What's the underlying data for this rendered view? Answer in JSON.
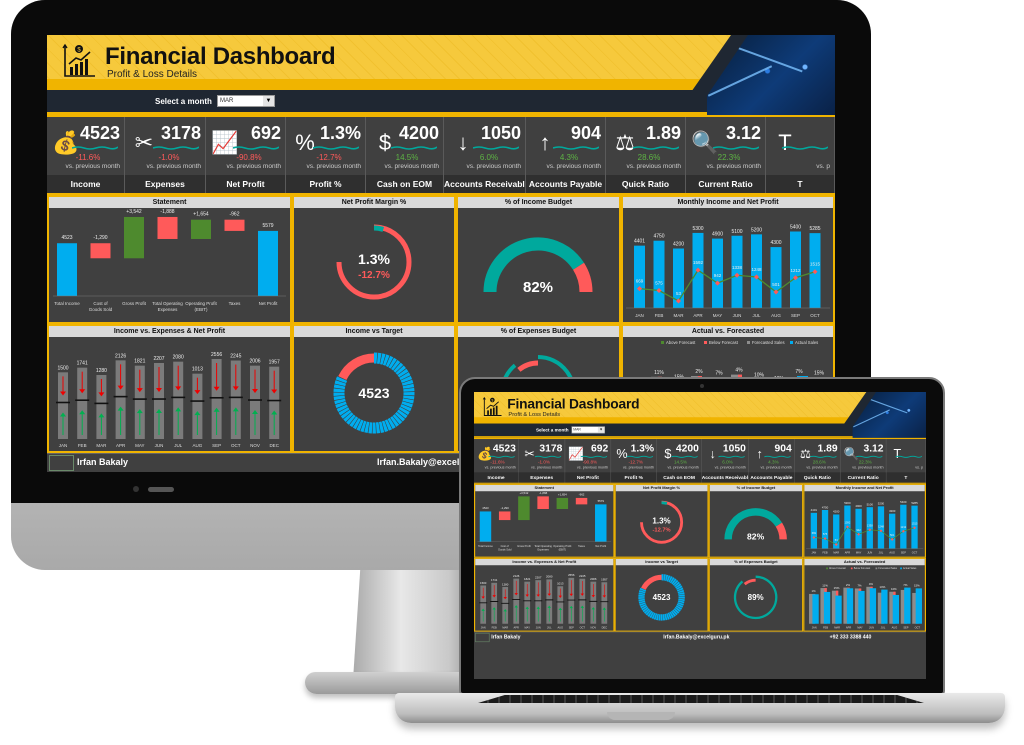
{
  "dashboard": {
    "title": "Financial Dashboard",
    "subtitle": "Profit & Loss Details",
    "month_selector": {
      "label": "Select a month",
      "value": "MAR"
    },
    "colors": {
      "accent": "#f0b400",
      "header_yellow": "#f6c93c",
      "navy": "#1f2732",
      "panel_bg": "#404040",
      "blue": "#00adef",
      "teal": "#00a99d",
      "red": "#ff5a5a",
      "green": "#4e8a2e",
      "bright_green": "#00b050"
    },
    "kpis": [
      {
        "icon": "money-bag-hand-icon",
        "glyph": "💰",
        "value": "4523",
        "change": "-11.6%",
        "trend": "negative",
        "vs": "vs. previous month",
        "label": "Income"
      },
      {
        "icon": "scissors-dollar-icon",
        "glyph": "✂",
        "value": "3178",
        "change": "-1.0%",
        "trend": "negative",
        "vs": "vs. previous month",
        "label": "Expenses"
      },
      {
        "icon": "growth-chart-icon",
        "glyph": "📈",
        "value": "692",
        "change": "-90.8%",
        "trend": "negative",
        "vs": "vs. previous month",
        "label": "Net Profit"
      },
      {
        "icon": "percent-hand-icon",
        "glyph": "%",
        "value": "1.3%",
        "change": "-12.7%",
        "trend": "negative",
        "vs": "vs. previous month",
        "label": "Profit %"
      },
      {
        "icon": "cash-bill-icon",
        "glyph": "$",
        "value": "4200",
        "change": "14.5%",
        "trend": "positive",
        "vs": "vs. previous month",
        "label": "Cash on EOM"
      },
      {
        "icon": "receivable-down-icon",
        "glyph": "↓",
        "value": "1050",
        "change": "6.0%",
        "trend": "positive",
        "vs": "vs. previous month",
        "label": "Accounts Receivable"
      },
      {
        "icon": "payable-up-icon",
        "glyph": "↑",
        "value": "904",
        "change": "4.3%",
        "trend": "positive",
        "vs": "vs. previous month",
        "label": "Accounts Payable"
      },
      {
        "icon": "balance-scale-icon",
        "glyph": "⚖",
        "value": "1.89",
        "change": "28.6%",
        "trend": "positive",
        "vs": "vs. previous month",
        "label": "Quick Ratio"
      },
      {
        "icon": "magnifier-ratio-icon",
        "glyph": "🔍",
        "value": "3.12",
        "change": "22.3%",
        "trend": "positive",
        "vs": "vs. previous month",
        "label": "Current Ratio"
      },
      {
        "icon": "tax-icon",
        "glyph": "T",
        "value": "",
        "change": "",
        "trend": "positive",
        "vs": "vs. p",
        "label": "T"
      }
    ],
    "panels": {
      "statement": "Statement",
      "npm": "Net Profit Margin %",
      "income_budget": "% of Income Budget",
      "monthly": "Monthly Income and Net Profit",
      "ive": "Income vs. Expenses & Net Profit",
      "target": "Income vs Target",
      "exp_budget": "% of Expenses Budget",
      "avf": "Actual vs. Forecasted"
    },
    "footer": {
      "name": "Irfan Bakaly",
      "email": "Irfan.Bakaly@excelguru.pk",
      "phone": "+92 333 3388 440"
    }
  },
  "chart_data": [
    {
      "type": "bar",
      "title": "Statement",
      "subtype": "waterfall",
      "categories": [
        "Total Income",
        "Cost of Goods Sold",
        "Gross Profit",
        "Total Operating Expenses",
        "Operating Profit (EBIT)",
        "Taxes",
        "Net Profit"
      ],
      "values": [
        4523,
        -1290,
        3542,
        -1888,
        1654,
        -962,
        5579
      ],
      "labels": [
        "4523",
        "-1,290",
        "+3,542",
        "-1,888",
        "+1,654",
        "-962",
        "5579"
      ]
    },
    {
      "type": "pie",
      "title": "Net Profit Margin %",
      "subtype": "donut",
      "value_label": "1.3%",
      "change_label": "-12.7%",
      "fraction_current": 0.05,
      "fraction_ring": 0.75
    },
    {
      "type": "pie",
      "title": "% of Income Budget",
      "subtype": "half-donut gauge",
      "value": 82,
      "value_label": "82%"
    },
    {
      "type": "bar",
      "title": "Monthly Income and Net Profit",
      "categories": [
        "JAN",
        "FEB",
        "MAR",
        "APR",
        "MAY",
        "JUN",
        "JUL",
        "AUG",
        "SEP",
        "OCT"
      ],
      "series": [
        {
          "name": "Income",
          "type": "bar",
          "values": [
            4401,
            4750,
            4200,
            5300,
            4900,
            5100,
            5200,
            4300,
            5400,
            5285
          ]
        },
        {
          "name": "Net Profit",
          "type": "line",
          "values": [
            669,
            575,
            53,
            1592,
            942,
            1338,
            1248,
            501,
            1212,
            1515
          ]
        }
      ],
      "ylim": [
        0,
        6000
      ]
    },
    {
      "type": "bar",
      "title": "Income vs. Expenses & Net Profit",
      "categories": [
        "JAN",
        "FEB",
        "MAR",
        "APR",
        "MAY",
        "JUN",
        "JUL",
        "AUG",
        "SEP",
        "OCT",
        "NOV",
        "DEC"
      ],
      "series": [
        {
          "name": "Net Profit",
          "values": [
            1500,
            1741,
            1280,
            2126,
            1821,
            2207,
            2080,
            1013,
            2556,
            2245,
            2006,
            1957
          ]
        },
        {
          "name": "Income",
          "values": [
            4401,
            4750,
            4200,
            5300,
            4900,
            5100,
            5200,
            4300,
            5400,
            5285,
            4900,
            4825
          ]
        },
        {
          "name": "Expenses",
          "values": [
            2901,
            3009,
            2920,
            3174,
            3079,
            2893,
            3120,
            3287,
            2844,
            3040,
            2894,
            2868
          ]
        }
      ],
      "ylim": [
        0,
        6000
      ]
    },
    {
      "type": "pie",
      "title": "Income vs Target",
      "subtype": "donut",
      "value_label": "4523",
      "fraction_achieved": 0.82
    },
    {
      "type": "pie",
      "title": "% of Expenses Budget",
      "subtype": "donut",
      "value_label": "89%",
      "value": 89
    },
    {
      "type": "bar",
      "title": "Actual vs. Forecasted",
      "legend": [
        "Above Forecast",
        "Below Forecast",
        "Forecasted Sales",
        "Actual Sales"
      ],
      "legend_position": "top-right",
      "categories": [
        "JAN",
        "FEB",
        "MAR",
        "APR",
        "MAY",
        "JUN",
        "JUL",
        "AUG",
        "SEP",
        "OCT"
      ],
      "variance_labels": [
        "1%",
        "11%",
        "15%",
        "2%",
        "7%",
        "4%",
        "10%",
        "10%",
        "7%",
        "15%"
      ],
      "series": [
        {
          "name": "Forecasted Sales",
          "values": [
            4450,
            5330,
            4940,
            5400,
            5270,
            5520,
            4640,
            4780,
            5050,
            4600
          ]
        },
        {
          "name": "Actual Sales",
          "values": [
            4401,
            4750,
            4200,
            5300,
            4900,
            5300,
            5100,
            4300,
            5400,
            5285
          ]
        }
      ]
    }
  ]
}
